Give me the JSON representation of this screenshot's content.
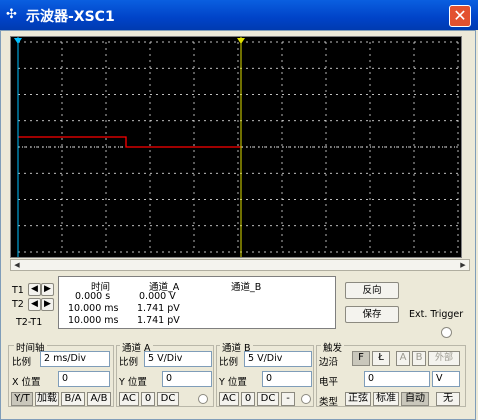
{
  "window": {
    "title": "示波器-XSC1"
  },
  "icons": {
    "app": "oscilloscope-icon",
    "close": "close-icon"
  },
  "colors": {
    "trace": "#ff0000",
    "grid": "#ffffff",
    "screen": "#000000",
    "cursor_t1": "#00c0ff",
    "cursor_t2": "#e0e000"
  },
  "readout": {
    "t1_label": "T1",
    "t2_label": "T2",
    "t2t1_label": "T2-T1",
    "headers": [
      "时间",
      "通道_A",
      "通道_B"
    ],
    "rows": [
      [
        "0.000 s",
        "0.000 V",
        ""
      ],
      [
        "10.000 ms",
        "1.741 pV",
        ""
      ],
      [
        "10.000 ms",
        "1.741 pV",
        ""
      ]
    ]
  },
  "buttons": {
    "reverse": "反向",
    "save": "保存",
    "ext_trigger": "Ext. Trigger"
  },
  "timebase": {
    "title": "时间轴",
    "scale_label": "比例",
    "scale_value": "2 ms/Div",
    "xpos_label": "X 位置",
    "xpos_value": "0",
    "modes": [
      "Y/T",
      "加载",
      "B/A",
      "A/B"
    ]
  },
  "channel_a": {
    "title": "通道 A",
    "scale_label": "比例",
    "scale_value": "5  V/Div",
    "ypos_label": "Y 位置",
    "ypos_value": "0",
    "coupling": [
      "AC",
      "0",
      "DC"
    ]
  },
  "channel_b": {
    "title": "通道 B",
    "scale_label": "比例",
    "scale_value": "5  V/Div",
    "ypos_label": "Y 位置",
    "ypos_value": "0",
    "coupling": [
      "AC",
      "0",
      "DC",
      "-"
    ]
  },
  "trigger": {
    "title": "触发",
    "edge_label": "边沿",
    "edge_buttons": [
      "F",
      "Ł",
      "A",
      "B",
      "外部"
    ],
    "level_label": "电平",
    "level_value": "0",
    "level_unit": "V",
    "type_label": "类型",
    "types": [
      "正弦",
      "标准",
      "自动",
      "无"
    ]
  }
}
